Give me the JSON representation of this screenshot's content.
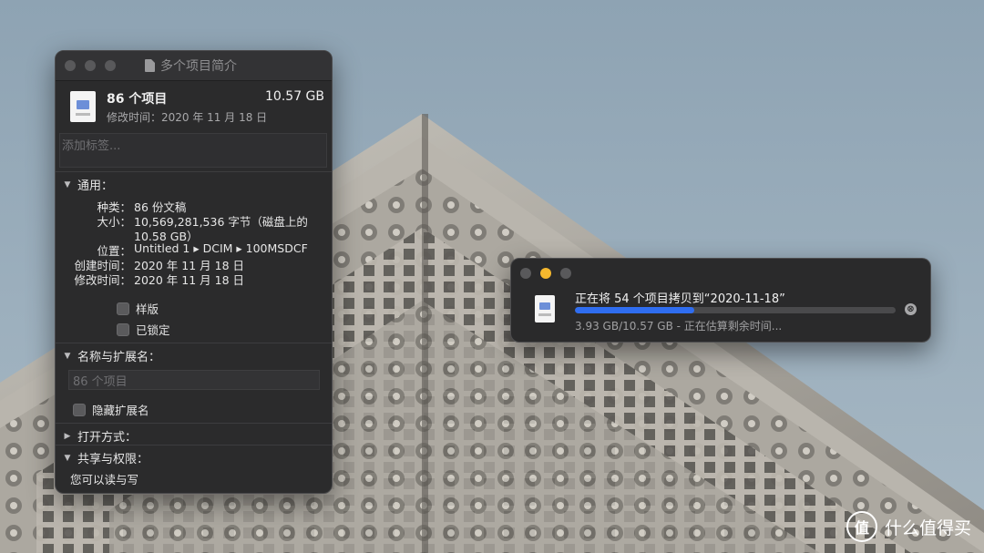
{
  "info_window": {
    "title": "多个项目简介",
    "item_count": "86 个项目",
    "total_size": "10.57 GB",
    "modified_line": "修改时间：2020 年 11 月 18 日",
    "tag_placeholder": "添加标签...",
    "general": {
      "header": "通用：",
      "rows": [
        {
          "key": "种类：",
          "value": "86 份文稿"
        },
        {
          "key": "大小：",
          "value": "10,569,281,536 字节（磁盘上的",
          "value2": "10.58 GB）"
        },
        {
          "key": "位置：",
          "value": "Untitled 1 ▸ DCIM ▸ 100MSDCF"
        },
        {
          "key": "创建时间：",
          "value": "2020 年 11 月 18 日"
        },
        {
          "key": "修改时间：",
          "value": "2020 年 11 月 18 日"
        }
      ],
      "stationery_label": "样版",
      "locked_label": "已锁定"
    },
    "name_ext": {
      "header": "名称与扩展名：",
      "name_placeholder": "86 个项目",
      "hide_ext_label": "隐藏扩展名"
    },
    "open_with_header": "打开方式：",
    "sharing": {
      "header": "共享与权限：",
      "summary": "您可以读与写"
    }
  },
  "copy_window": {
    "title": "正在将 54 个项目拷贝到“2020-11-18”",
    "status": "3.93 GB/10.57 GB - 正在估算剩余时间...",
    "progress": 0.372,
    "cancel_icon": "⊗"
  },
  "colors": {
    "traffic_inactive": "#59595b",
    "traffic_minimize": "#f5b82e",
    "progress_fill": "#2f6df0"
  },
  "watermark": {
    "logo_glyph": "值",
    "text": "什么值得买"
  }
}
